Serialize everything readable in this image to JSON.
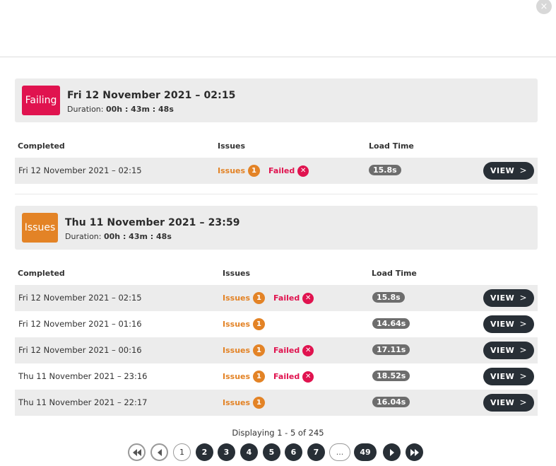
{
  "close_icon": "×",
  "groups": [
    {
      "status": "Failing",
      "title": "Fri 12 November 2021 – 02:15",
      "duration_label": "Duration:",
      "duration_value": "00h : 43m : 48s",
      "columns": [
        "Completed",
        "Issues",
        "Load Time"
      ],
      "rows": [
        {
          "completed": "Fri 12 November 2021 – 02:15",
          "issues_label": "Issues",
          "issues_count": "1",
          "failed_label": "Failed",
          "load_time": "15.8s",
          "view_label": "VIEW"
        }
      ]
    },
    {
      "status": "Issues",
      "title": "Thu 11 November 2021 – 23:59",
      "duration_label": "Duration:",
      "duration_value": "00h : 43m : 48s",
      "columns": [
        "Completed",
        "Issues",
        "Load Time"
      ],
      "rows": [
        {
          "completed": "Fri 12 November 2021 – 02:15",
          "issues_label": "Issues",
          "issues_count": "1",
          "failed_label": "Failed",
          "load_time": "15.8s",
          "view_label": "VIEW"
        },
        {
          "completed": "Fri 12 November 2021 – 01:16",
          "issues_label": "Issues",
          "issues_count": "1",
          "failed_label": "",
          "load_time": "14.64s",
          "view_label": "VIEW"
        },
        {
          "completed": "Fri 12 November 2021 – 00:16",
          "issues_label": "Issues",
          "issues_count": "1",
          "failed_label": "Failed",
          "load_time": "17.11s",
          "view_label": "VIEW"
        },
        {
          "completed": "Thu 11 November 2021 – 23:16",
          "issues_label": "Issues",
          "issues_count": "1",
          "failed_label": "Failed",
          "load_time": "18.52s",
          "view_label": "VIEW"
        },
        {
          "completed": "Thu 11 November 2021 – 22:17",
          "issues_label": "Issues",
          "issues_count": "1",
          "failed_label": "",
          "load_time": "16.04s",
          "view_label": "VIEW"
        }
      ]
    }
  ],
  "pagination": {
    "info": "Displaying 1 - 5 of 245",
    "first_icon": "first-page-icon",
    "prev_icon": "prev-page-icon",
    "pages": [
      "1",
      "2",
      "3",
      "4",
      "5",
      "6",
      "7",
      "...",
      "49"
    ],
    "current": "1",
    "next_icon": "next-page-icon",
    "last_icon": "last-page-icon"
  },
  "colors": {
    "failing": "#e0134f",
    "issues": "#e38326",
    "dark_button": "#282f36",
    "header_bg": "#ececec"
  }
}
